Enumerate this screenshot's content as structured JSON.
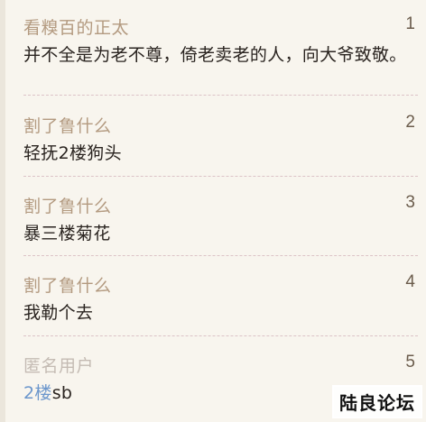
{
  "posts": [
    {
      "author": "看糗百的正太",
      "floor": "1",
      "content": "并不全是为老不尊，倚老卖老的人，向大爷致敬。"
    },
    {
      "author": "割了鲁什么",
      "floor": "2",
      "content": "轻抚2楼狗头"
    },
    {
      "author": "割了鲁什么",
      "floor": "3",
      "content": "暴三楼菊花"
    },
    {
      "author": "割了鲁什么",
      "floor": "4",
      "content": "我勒个去"
    },
    {
      "author": "匿名用户",
      "floor": "5",
      "content_mention": "2楼",
      "content_rest": "sb"
    }
  ],
  "watermark": "陆良论坛",
  "colors": {
    "background": "#f8f5ee",
    "author": "#b39a80",
    "anonymous_author": "#c4bbb3",
    "content": "#2a2420",
    "mention": "#6c97cc",
    "divider": "#dcc3c7"
  }
}
